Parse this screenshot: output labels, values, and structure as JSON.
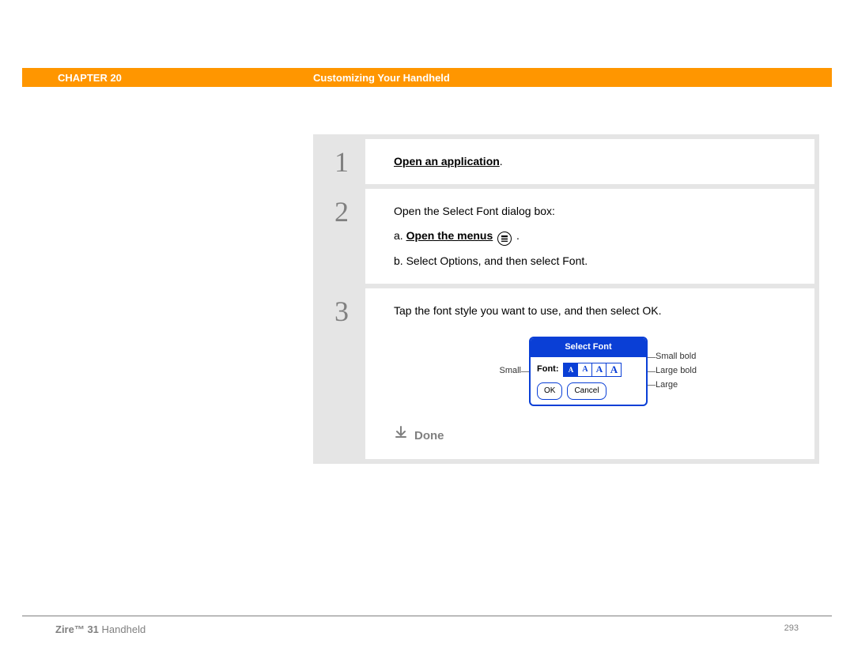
{
  "header": {
    "chapter": "CHAPTER 20",
    "title": "Customizing Your Handheld"
  },
  "steps": [
    {
      "num": "1",
      "lead_link": "Open an application",
      "lead_suffix": "."
    },
    {
      "num": "2",
      "lead_text": "Open the Select Font dialog box:",
      "sub_a_prefix": "a.  ",
      "sub_a_link": "Open the menus",
      "sub_a_suffix": " .",
      "sub_b": "b.  Select Options, and then select Font."
    },
    {
      "num": "3",
      "lead_text": "Tap the font style you want to use, and then select OK.",
      "dialog": {
        "title": "Select Font",
        "font_label": "Font:",
        "options": [
          "A",
          "A",
          "A",
          "A"
        ],
        "ok": "OK",
        "cancel": "Cancel",
        "callout_left": "Small",
        "callouts_right": [
          "Small bold",
          "Large bold",
          "Large"
        ]
      },
      "done": "Done"
    }
  ],
  "footer": {
    "product_bold": "Zire™ 31",
    "product_rest": " Handheld",
    "page": "293"
  }
}
